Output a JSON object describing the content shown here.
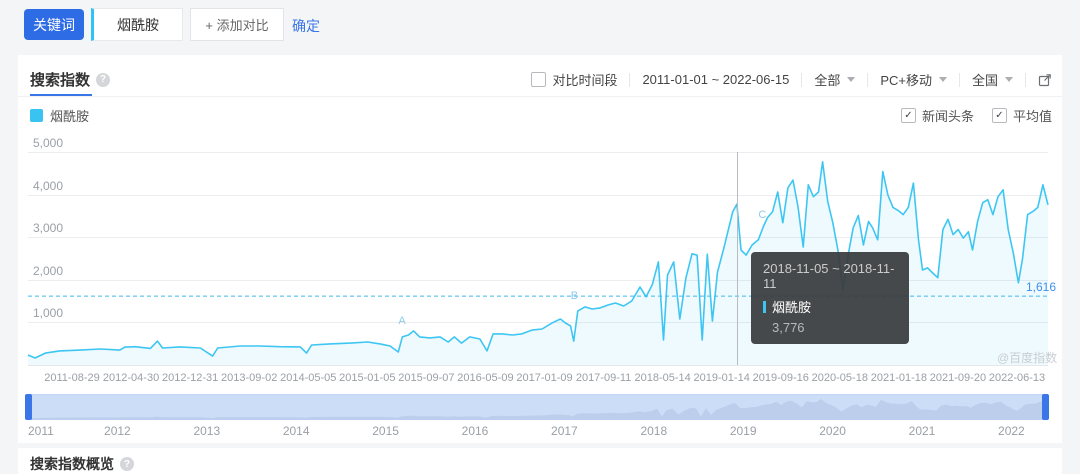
{
  "topbar": {
    "keyword_button": "关键词",
    "keyword_value": "烟酰胺",
    "add_compare": "+ 添加对比",
    "confirm": "确定"
  },
  "panel": {
    "title": "搜索指数",
    "filters": {
      "compare_label": "对比时间段",
      "date_range": "2011-01-01 ~ 2022-06-15",
      "scope": "全部",
      "device": "PC+移动",
      "region": "全国"
    },
    "legend": {
      "name": "烟酰胺",
      "color": "#38c3f1"
    },
    "toggles": [
      {
        "label": "新闻头条",
        "checked": true
      },
      {
        "label": "平均值",
        "checked": true
      }
    ]
  },
  "tooltip": {
    "date_range": "2018-11-05 ~ 2018-11-11",
    "series": "烟酰胺",
    "value": "3,776"
  },
  "watermark": "@百度指数",
  "overview_title": "搜索指数概览",
  "timeline": {
    "years": [
      "2011",
      "2012",
      "2013",
      "2014",
      "2015",
      "2016",
      "2017",
      "2018",
      "2019",
      "2020",
      "2021",
      "2022"
    ]
  },
  "chart_data": {
    "type": "line",
    "title": "搜索指数",
    "ylim": [
      0,
      5000
    ],
    "yticks": [
      1000,
      2000,
      3000,
      4000,
      5000
    ],
    "grid": true,
    "legend_position": "top-left",
    "x_tick_labels": [
      "2011-08-29",
      "2012-04-30",
      "2012-12-31",
      "2013-09-02",
      "2014-05-05",
      "2015-01-05",
      "2015-09-07",
      "2016-05-09",
      "2017-01-09",
      "2017-09-11",
      "2018-05-14",
      "2019-01-14",
      "2019-09-16",
      "2020-05-18",
      "2021-01-18",
      "2021-09-20",
      "2022-06-13"
    ],
    "average": {
      "value": 1616,
      "label": "1,616"
    },
    "markers": [
      {
        "label": "A",
        "x": 0.367,
        "y": 0.798
      },
      {
        "label": "B",
        "x": 0.536,
        "y": 0.681
      },
      {
        "label": "C",
        "x": 0.72,
        "y": 0.3
      }
    ],
    "crosshair_x": 0.695,
    "series": [
      {
        "name": "烟酰胺",
        "color": "#3ec6f3",
        "points": [
          [
            0,
            235
          ],
          [
            0.007,
            165
          ],
          [
            0.017,
            280
          ],
          [
            0.031,
            330
          ],
          [
            0.051,
            350
          ],
          [
            0.071,
            375
          ],
          [
            0.09,
            350
          ],
          [
            0.095,
            420
          ],
          [
            0.105,
            430
          ],
          [
            0.12,
            390
          ],
          [
            0.127,
            560
          ],
          [
            0.132,
            400
          ],
          [
            0.149,
            425
          ],
          [
            0.169,
            400
          ],
          [
            0.181,
            210
          ],
          [
            0.186,
            400
          ],
          [
            0.208,
            445
          ],
          [
            0.227,
            445
          ],
          [
            0.247,
            430
          ],
          [
            0.267,
            425
          ],
          [
            0.273,
            280
          ],
          [
            0.278,
            470
          ],
          [
            0.296,
            495
          ],
          [
            0.316,
            515
          ],
          [
            0.333,
            540
          ],
          [
            0.345,
            495
          ],
          [
            0.355,
            445
          ],
          [
            0.363,
            305
          ],
          [
            0.367,
            660
          ],
          [
            0.373,
            705
          ],
          [
            0.378,
            800
          ],
          [
            0.384,
            660
          ],
          [
            0.394,
            635
          ],
          [
            0.404,
            660
          ],
          [
            0.412,
            540
          ],
          [
            0.418,
            660
          ],
          [
            0.425,
            515
          ],
          [
            0.433,
            660
          ],
          [
            0.443,
            610
          ],
          [
            0.45,
            330
          ],
          [
            0.456,
            730
          ],
          [
            0.465,
            730
          ],
          [
            0.475,
            705
          ],
          [
            0.484,
            730
          ],
          [
            0.494,
            820
          ],
          [
            0.504,
            845
          ],
          [
            0.514,
            990
          ],
          [
            0.522,
            1080
          ],
          [
            0.527,
            985
          ],
          [
            0.532,
            915
          ],
          [
            0.535,
            560
          ],
          [
            0.539,
            1270
          ],
          [
            0.546,
            1365
          ],
          [
            0.553,
            1315
          ],
          [
            0.561,
            1340
          ],
          [
            0.569,
            1410
          ],
          [
            0.576,
            1455
          ],
          [
            0.584,
            1385
          ],
          [
            0.592,
            1505
          ],
          [
            0.6,
            1830
          ],
          [
            0.606,
            1600
          ],
          [
            0.612,
            1880
          ],
          [
            0.618,
            2420
          ],
          [
            0.623,
            590
          ],
          [
            0.627,
            2110
          ],
          [
            0.633,
            2420
          ],
          [
            0.639,
            1080
          ],
          [
            0.645,
            2040
          ],
          [
            0.651,
            2610
          ],
          [
            0.656,
            2580
          ],
          [
            0.661,
            590
          ],
          [
            0.666,
            2600
          ],
          [
            0.671,
            1030
          ],
          [
            0.676,
            2180
          ],
          [
            0.682,
            2720
          ],
          [
            0.687,
            3210
          ],
          [
            0.691,
            3600
          ],
          [
            0.695,
            3776
          ],
          [
            0.699,
            2700
          ],
          [
            0.704,
            2580
          ],
          [
            0.71,
            2820
          ],
          [
            0.716,
            2940
          ],
          [
            0.721,
            3250
          ],
          [
            0.725,
            3460
          ],
          [
            0.73,
            3600
          ],
          [
            0.735,
            4060
          ],
          [
            0.74,
            3340
          ],
          [
            0.745,
            4160
          ],
          [
            0.75,
            4340
          ],
          [
            0.755,
            3700
          ],
          [
            0.76,
            2770
          ],
          [
            0.765,
            4230
          ],
          [
            0.77,
            3950
          ],
          [
            0.775,
            4060
          ],
          [
            0.779,
            4770
          ],
          [
            0.784,
            3840
          ],
          [
            0.789,
            3340
          ],
          [
            0.794,
            2700
          ],
          [
            0.799,
            1760
          ],
          [
            0.804,
            2580
          ],
          [
            0.809,
            3220
          ],
          [
            0.814,
            3510
          ],
          [
            0.819,
            2820
          ],
          [
            0.824,
            3370
          ],
          [
            0.828,
            3220
          ],
          [
            0.833,
            2940
          ],
          [
            0.838,
            4540
          ],
          [
            0.843,
            3990
          ],
          [
            0.848,
            3700
          ],
          [
            0.853,
            3630
          ],
          [
            0.858,
            3530
          ],
          [
            0.863,
            3700
          ],
          [
            0.868,
            4270
          ],
          [
            0.873,
            2940
          ],
          [
            0.877,
            2230
          ],
          [
            0.882,
            2280
          ],
          [
            0.887,
            2160
          ],
          [
            0.892,
            2050
          ],
          [
            0.897,
            3180
          ],
          [
            0.902,
            3420
          ],
          [
            0.907,
            3060
          ],
          [
            0.912,
            3180
          ],
          [
            0.917,
            2980
          ],
          [
            0.922,
            3130
          ],
          [
            0.926,
            2700
          ],
          [
            0.931,
            3370
          ],
          [
            0.936,
            3810
          ],
          [
            0.941,
            3880
          ],
          [
            0.946,
            3530
          ],
          [
            0.951,
            3950
          ],
          [
            0.956,
            4110
          ],
          [
            0.961,
            3180
          ],
          [
            0.966,
            2630
          ],
          [
            0.971,
            1930
          ],
          [
            0.975,
            2490
          ],
          [
            0.98,
            3530
          ],
          [
            0.985,
            3600
          ],
          [
            0.99,
            3700
          ],
          [
            0.995,
            4230
          ],
          [
            1,
            3760
          ]
        ]
      }
    ]
  }
}
